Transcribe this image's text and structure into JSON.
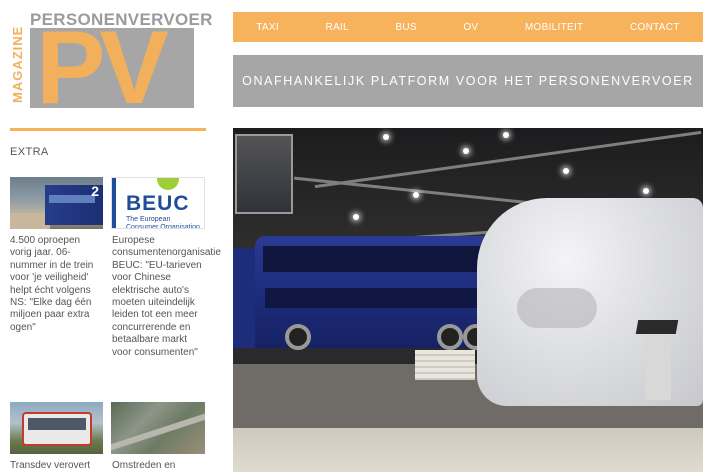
{
  "logo": {
    "brand_text": "PERSONENVERVOER",
    "vertical_text": "MAGAZINE",
    "monogram": "PV"
  },
  "nav": {
    "items": [
      "TAXI",
      "RAIL",
      "BUS",
      "OV",
      "MOBILITEIT",
      "CONTACT"
    ]
  },
  "banner": {
    "tagline": "ONAFHANKELIJK PLATFORM VOOR HET PERSONENVERVOER"
  },
  "sidebar": {
    "section_title": "EXTRA",
    "articles": [
      {
        "caption": "4.500 oproepen vorig jaar. 06-nummer in de trein voor 'je veiligheid' helpt écht volgens NS: \"Elke dag één miljoen paar extra ogen\"",
        "thumb_badge": "2"
      },
      {
        "caption": "Europese consumentenorganisatie BEUC: \"EU-tarieven voor Chinese elektrische auto's moeten uiteindelijk leiden tot een meer concurrerende en betaalbare markt voor consumenten\"",
        "thumb_logo": "BEUC",
        "thumb_sub": "The European Consumer Organisation"
      },
      {
        "caption": "Transdev verovert"
      },
      {
        "caption": "Omstreden en"
      }
    ]
  },
  "colors": {
    "accent_orange": "#f7b25c",
    "banner_gray": "#a6a6a6",
    "beuc_blue": "#1f4d9c"
  },
  "icons": {
    "hero": "bus-exhibition-photo"
  }
}
